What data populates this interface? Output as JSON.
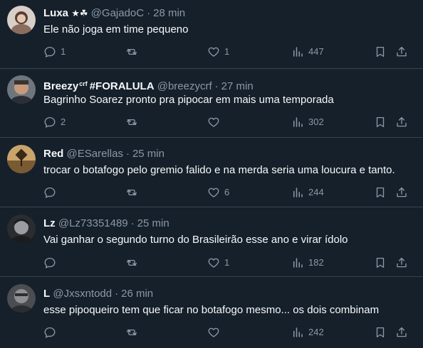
{
  "tweets": [
    {
      "name": "Luxa",
      "badges": "★☘",
      "handle": "@GajadoC",
      "separator": "·",
      "time": "28 min",
      "text": "Ele não joga em time pequeno",
      "replies": "1",
      "retweets": "",
      "likes": "1",
      "views": "447",
      "avatar_color": "#d8cfc8"
    },
    {
      "name": "Breezy",
      "affiliation": "crf",
      "tag": "#FORALULA",
      "handle": "@breezycrf",
      "separator": "·",
      "time": "27 min",
      "text": "Bagrinho Soarez pronto pra pipocar em mais uma temporada",
      "replies": "2",
      "retweets": "",
      "likes": "",
      "views": "302",
      "avatar_color": "#7a7f86"
    },
    {
      "name": "Red",
      "handle": "@ESarellas",
      "separator": "·",
      "time": "25 min",
      "text": "trocar o botafogo pelo gremio falido e na merda seria uma loucura e tanto.",
      "replies": "",
      "retweets": "",
      "likes": "6",
      "views": "244",
      "avatar_color": "#b8924e"
    },
    {
      "name": "Lz",
      "handle": "@Lz73351489",
      "separator": "·",
      "time": "25 min",
      "text": "Vai ganhar o segundo turno do Brasileirão esse ano e virar ídolo",
      "replies": "",
      "retweets": "",
      "likes": "1",
      "views": "182",
      "avatar_color": "#3a3d40"
    },
    {
      "name": "L",
      "handle": "@Jxsxntodd",
      "separator": "·",
      "time": "26 min",
      "text": "esse pipoqueiro  tem que ficar no botafogo  mesmo... os dois combinam",
      "replies": "",
      "retweets": "",
      "likes": "",
      "views": "242",
      "avatar_color": "#5b5e62"
    }
  ],
  "colors": {
    "background": "#15202b",
    "divider": "#38444d",
    "primary_text": "#f7f9f9",
    "secondary_text": "#8b98a5"
  }
}
